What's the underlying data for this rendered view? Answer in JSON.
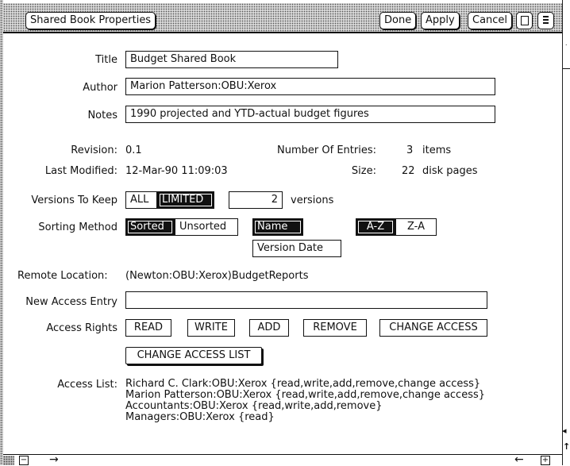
{
  "window": {
    "title": "Shared Book Properties",
    "buttons": {
      "done": "Done",
      "apply": "Apply",
      "cancel": "Cancel"
    }
  },
  "fields": {
    "title": {
      "label": "Title",
      "value": "Budget Shared Book"
    },
    "author": {
      "label": "Author",
      "value": "Marion Patterson:OBU:Xerox"
    },
    "notes": {
      "label": "Notes",
      "value": "1990 projected and YTD-actual budget figures"
    }
  },
  "info": {
    "revision_label": "Revision:",
    "revision_value": "0.1",
    "entries_label": "Number Of Entries:",
    "entries_value": "3",
    "entries_unit": "items",
    "modified_label": "Last Modified:",
    "modified_value": "12-Mar-90 11:09:03",
    "size_label": "Size:",
    "size_value": "22",
    "size_unit": "disk pages"
  },
  "versions": {
    "label": "Versions To Keep",
    "options": [
      "ALL",
      "LIMITED"
    ],
    "selected": "LIMITED",
    "count": "2",
    "unit": "versions"
  },
  "sorting": {
    "label": "Sorting Method",
    "mode_options": [
      "Sorted",
      "Unsorted"
    ],
    "mode_selected": "Sorted",
    "key_options": [
      "Name",
      "Version Date"
    ],
    "key_selected": "Name",
    "order_options": [
      "A-Z",
      "Z-A"
    ],
    "order_selected": "A-Z"
  },
  "remote": {
    "label": "Remote Location:",
    "value": "(Newton:OBU:Xerox)BudgetReports"
  },
  "access": {
    "new_entry_label": "New Access Entry",
    "new_entry_value": "",
    "rights_label": "Access Rights",
    "rights": [
      "READ",
      "WRITE",
      "ADD",
      "REMOVE",
      "CHANGE ACCESS"
    ],
    "change_list_button": "CHANGE ACCESS LIST",
    "list_label": "Access List:",
    "list": [
      "Richard C. Clark:OBU:Xerox {read,write,add,remove,change access}",
      "Marion Patterson:OBU:Xerox {read,write,add,remove,change access}",
      "Accountants:OBU:Xerox {read,write,add,remove}",
      "Managers:OBU:Xerox {read}"
    ]
  }
}
